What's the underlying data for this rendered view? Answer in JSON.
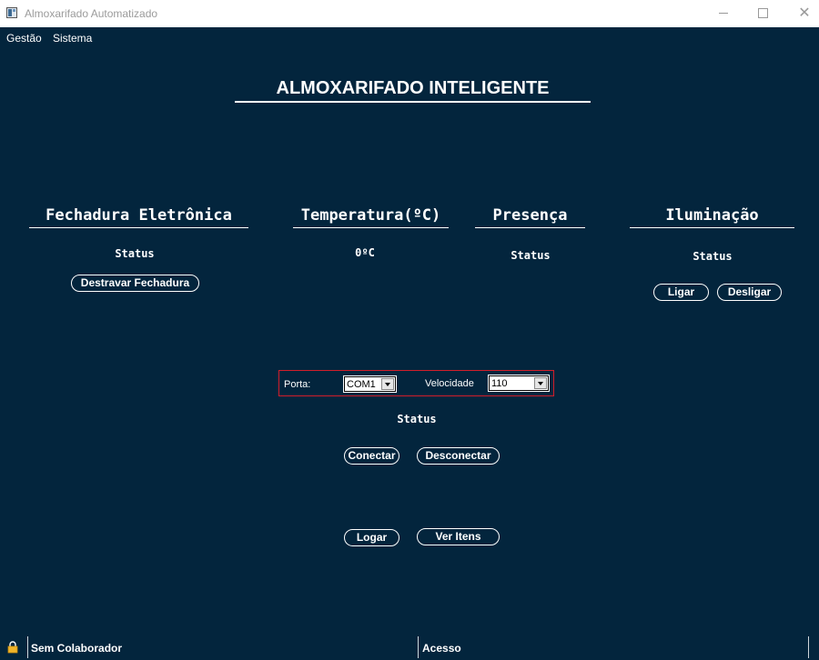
{
  "window": {
    "title": "Almoxarifado Automatizado"
  },
  "menu": {
    "items": [
      "Gestão",
      "Sistema"
    ]
  },
  "main_title": "ALMOXARIFADO INTELIGENTE",
  "sections": {
    "lock": {
      "title": "Fechadura Eletrônica",
      "status": "Status",
      "button": "Destravar Fechadura"
    },
    "temperature": {
      "title": "Temperatura(ºC)",
      "value": "0ºC"
    },
    "presence": {
      "title": "Presença",
      "status": "Status"
    },
    "lighting": {
      "title": "Iluminação",
      "status": "Status",
      "on_button": "Ligar",
      "off_button": "Desligar"
    }
  },
  "serial": {
    "port_label": "Porta:",
    "port_value": "COM1",
    "speed_label": "Velocidade",
    "speed_value": "110",
    "border_color": "#d21e2a"
  },
  "connection": {
    "status": "Status",
    "connect_button": "Conectar",
    "disconnect_button": "Desconectar"
  },
  "actions": {
    "login_button": "Logar",
    "items_button": "Ver Itens"
  },
  "statusbar": {
    "collaborator": "Sem Colaborador",
    "access": "Acesso",
    "icon": "lock-icon"
  },
  "colors": {
    "background": "#03253d",
    "text": "#ffffff",
    "accent_border": "#d21e2a"
  }
}
